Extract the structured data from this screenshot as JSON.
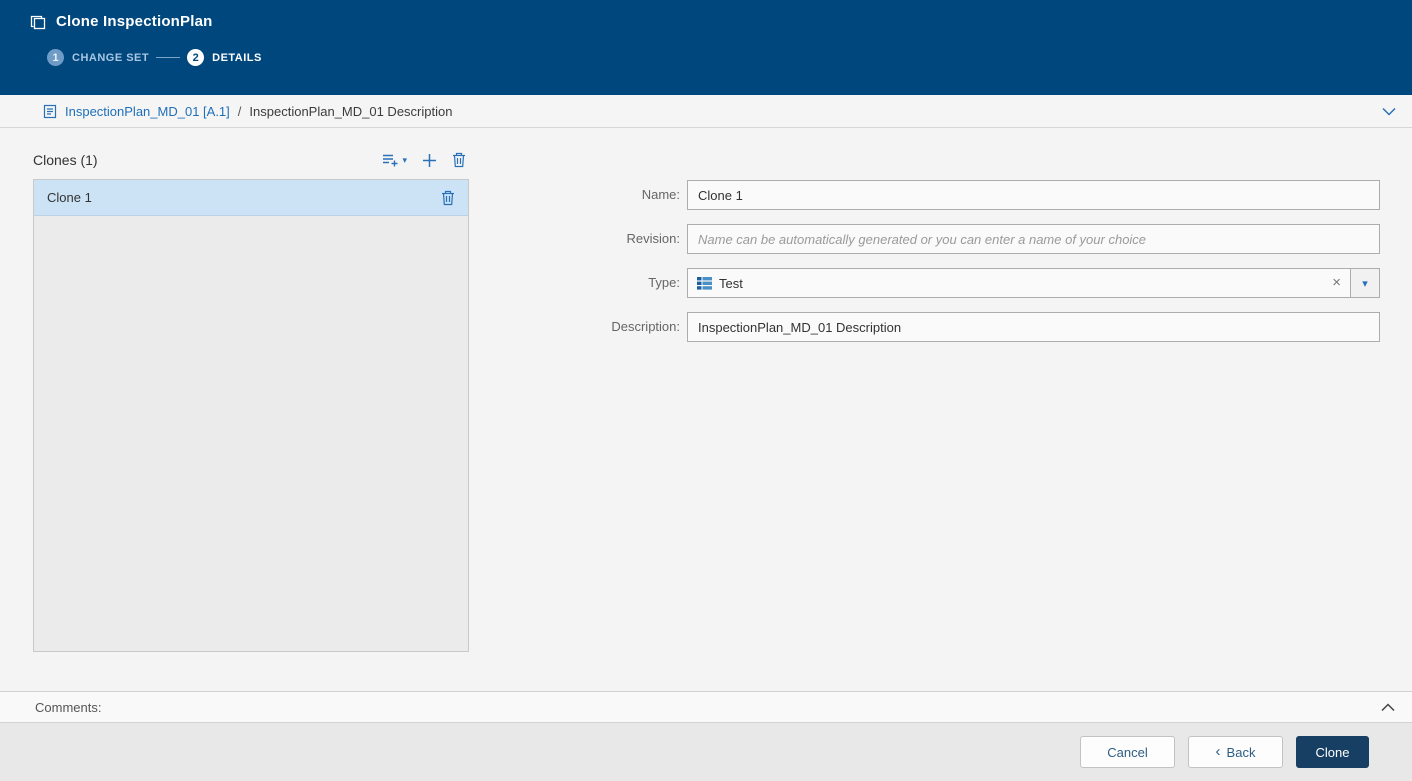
{
  "header": {
    "title": "Clone InspectionPlan",
    "steps": [
      {
        "number": "1",
        "label": "CHANGE SET"
      },
      {
        "number": "2",
        "label": "DETAILS"
      }
    ]
  },
  "breadcrumb": {
    "link": "InspectionPlan_MD_01 [A.1]",
    "separator": "/",
    "current": "InspectionPlan_MD_01 Description"
  },
  "clones_panel": {
    "title": "Clones (1)",
    "items": [
      {
        "name": "Clone 1"
      }
    ]
  },
  "form": {
    "name": {
      "label": "Name:",
      "value": "Clone 1"
    },
    "revision": {
      "label": "Revision:",
      "value": "",
      "placeholder": "Name can be automatically generated or you can enter a name of your choice"
    },
    "type": {
      "label": "Type:",
      "value": "Test"
    },
    "description": {
      "label": "Description:",
      "value": "InspectionPlan_MD_01 Description"
    }
  },
  "comments": {
    "label": "Comments:"
  },
  "footer": {
    "cancel": "Cancel",
    "back": "Back",
    "clone": "Clone"
  },
  "icons": {
    "clear": "×",
    "back_chevron": "‹",
    "dropdown_caret": "▾",
    "toolbar_caret": "▾"
  },
  "colors": {
    "header_bg": "#00477e",
    "accent_blue": "#2a70b8",
    "link_blue": "#1e6fba",
    "selection_bg": "#cbe3f5",
    "primary_button_bg": "#163f63"
  }
}
